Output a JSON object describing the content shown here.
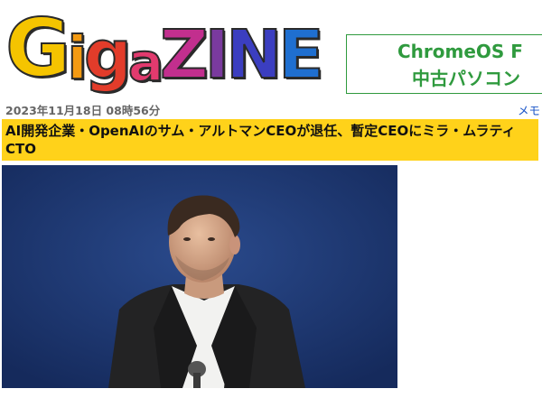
{
  "site": {
    "logo_letters": [
      "G",
      "i",
      "g",
      "a",
      "Z",
      "I",
      "N",
      "E"
    ]
  },
  "ad": {
    "line1": "ChromeOS F",
    "line2": "中古パソコン"
  },
  "article": {
    "date": "2023年11月18日 08時56分",
    "category": "メモ",
    "headline": "AI開発企業・OpenAIのサム・アルトマンCEOが退任、暫定CEOにミラ・ムラティCTO"
  },
  "colors": {
    "headline_bg": "#ffd21a",
    "ad_green": "#2f9a3e",
    "link_blue": "#1a55c8",
    "photo_bg": "#1d3468"
  }
}
